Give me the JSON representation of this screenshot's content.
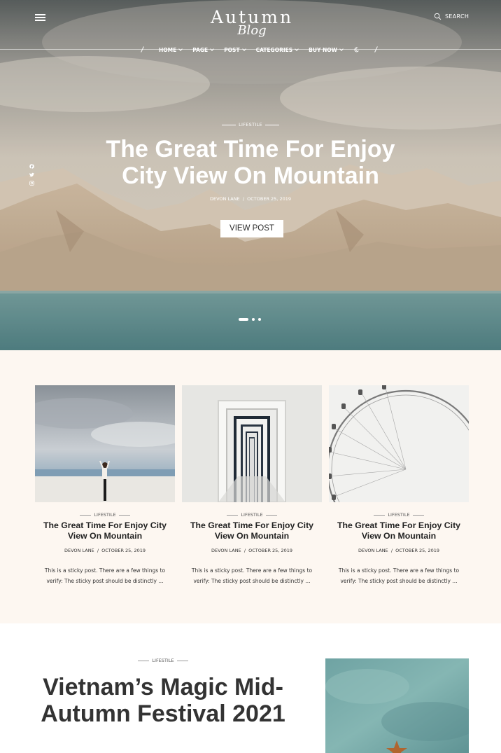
{
  "brand": {
    "name_main": "Autumn",
    "name_script": "Blog"
  },
  "header": {
    "search_label": "SEARCH"
  },
  "nav": {
    "items": [
      {
        "label": "HOME"
      },
      {
        "label": "PAGE"
      },
      {
        "label": "POST"
      },
      {
        "label": "CATEGORIES"
      },
      {
        "label": "BUY NOW"
      }
    ]
  },
  "social": [
    "facebook-icon",
    "twitter-icon",
    "instagram-icon"
  ],
  "hero": {
    "category": "LIFESTILE",
    "title_line1": "The Great Time For Enjoy",
    "title_line2": "City View On Mountain",
    "author": "DEVON LANE",
    "separator": "/",
    "date": "OCTOBER 25, 2019",
    "button_label": "VIEW POST",
    "slides": 3,
    "active_slide": 1
  },
  "featured": [
    {
      "category": "LIFESTILE",
      "title": "The Great Time For Enjoy City View On Mountain",
      "author": "DEVON LANE",
      "separator": "/",
      "date": "OCTOBER 25, 2019",
      "excerpt": "This is a sticky post. There are a few things to verify: The sticky post should be distinctly ..."
    },
    {
      "category": "LIFESTILE",
      "title": "The Great Time For Enjoy City View On Mountain",
      "author": "DEVON LANE",
      "separator": "/",
      "date": "OCTOBER 25, 2019",
      "excerpt": "This is a sticky post. There are a few things to verify: The sticky post should be distinctly ..."
    },
    {
      "category": "LIFESTILE",
      "title": "The Great Time For Enjoy City View On Mountain",
      "author": "DEVON LANE",
      "separator": "/",
      "date": "OCTOBER 25, 2019",
      "excerpt": "This is a sticky post. There are a few things to verify: The sticky post should be distinctly ..."
    }
  ],
  "article": {
    "category": "LIFESTILE",
    "title": "Vietnam’s Magic Mid-Autumn Festival 2021"
  },
  "colors": {
    "section_bg": "#fdf7f1",
    "text_dark": "#2a2a2a",
    "white": "#ffffff"
  }
}
